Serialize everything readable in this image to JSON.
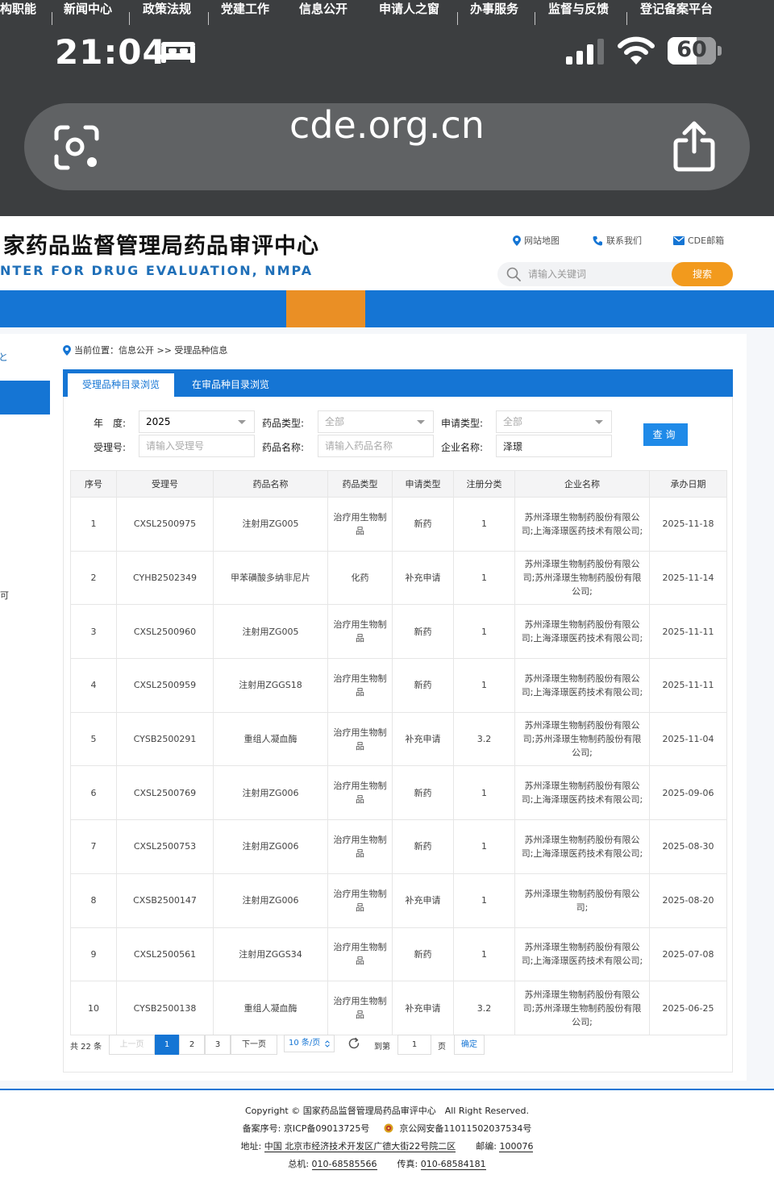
{
  "status_bar": {
    "time": "21:04",
    "battery": "60",
    "battery_level": 0.6
  },
  "browser": {
    "url": "cde.org.cn"
  },
  "site": {
    "title": "家药品监督管理局药品审评中心",
    "subtitle": "NTER FOR DRUG EVALUATION, NMPA",
    "links": {
      "sitemap": "网站地图",
      "contact": "联系我们",
      "mail": "CDE邮箱"
    },
    "search": {
      "placeholder": "请输入关键词",
      "button": "搜索"
    }
  },
  "nav": {
    "items": [
      "构职能",
      "新闻中心",
      "政策法规",
      "党建工作",
      "信息公开",
      "申请人之窗",
      "办事服务",
      "监督与反馈",
      "登记备案平台"
    ],
    "active": "信息公开"
  },
  "sidebar": {
    "fragment_top": "と",
    "fragment_mid": "可"
  },
  "breadcrumb": "当前位置：信息公开 >> 受理品种信息",
  "tabs": {
    "active": "受理品种目录浏览",
    "other": "在审品种目录浏览"
  },
  "filters": {
    "year_label": "年　度:",
    "year_value": "2025",
    "drug_type_label": "药品类型:",
    "drug_type_value": "全部",
    "apply_type_label": "申请类型:",
    "apply_type_value": "全部",
    "accept_no_label": "受理号:",
    "accept_no_placeholder": "请输入受理号",
    "drug_name_label": "药品名称:",
    "drug_name_placeholder": "请输入药品名称",
    "company_label": "企业名称:",
    "company_value": "泽璟",
    "query_button": "查询"
  },
  "table": {
    "headers": [
      "序号",
      "受理号",
      "药品名称",
      "药品类型",
      "申请类型",
      "注册分类",
      "企业名称",
      "承办日期"
    ],
    "rows": [
      [
        "1",
        "CXSL2500975",
        "注射用ZG005",
        "治疗用生物制品",
        "新药",
        "1",
        "苏州泽璟生物制药股份有限公司;上海泽璟医药技术有限公司;",
        "2025-11-18"
      ],
      [
        "2",
        "CYHB2502349",
        "甲苯磺酸多纳非尼片",
        "化药",
        "补充申请",
        "1",
        "苏州泽璟生物制药股份有限公司;苏州泽璟生物制药股份有限公司;",
        "2025-11-14"
      ],
      [
        "3",
        "CXSL2500960",
        "注射用ZG005",
        "治疗用生物制品",
        "新药",
        "1",
        "苏州泽璟生物制药股份有限公司;上海泽璟医药技术有限公司;",
        "2025-11-11"
      ],
      [
        "4",
        "CXSL2500959",
        "注射用ZGGS18",
        "治疗用生物制品",
        "新药",
        "1",
        "苏州泽璟生物制药股份有限公司;上海泽璟医药技术有限公司;",
        "2025-11-11"
      ],
      [
        "5",
        "CYSB2500291",
        "重组人凝血酶",
        "治疗用生物制品",
        "补充申请",
        "3.2",
        "苏州泽璟生物制药股份有限公司;苏州泽璟生物制药股份有限公司;",
        "2025-11-04"
      ],
      [
        "6",
        "CXSL2500769",
        "注射用ZG006",
        "治疗用生物制品",
        "新药",
        "1",
        "苏州泽璟生物制药股份有限公司;上海泽璟医药技术有限公司;",
        "2025-09-06"
      ],
      [
        "7",
        "CXSL2500753",
        "注射用ZG006",
        "治疗用生物制品",
        "新药",
        "1",
        "苏州泽璟生物制药股份有限公司;上海泽璟医药技术有限公司;",
        "2025-08-30"
      ],
      [
        "8",
        "CXSB2500147",
        "注射用ZG006",
        "治疗用生物制品",
        "补充申请",
        "1",
        "苏州泽璟生物制药股份有限公司;",
        "2025-08-20"
      ],
      [
        "9",
        "CXSL2500561",
        "注射用ZGGS34",
        "治疗用生物制品",
        "新药",
        "1",
        "苏州泽璟生物制药股份有限公司;上海泽璟医药技术有限公司;",
        "2025-07-08"
      ],
      [
        "10",
        "CYSB2500138",
        "重组人凝血酶",
        "治疗用生物制品",
        "补充申请",
        "3.2",
        "苏州泽璟生物制药股份有限公司;苏州泽璟生物制药股份有限公司;",
        "2025-06-25"
      ]
    ]
  },
  "pagination": {
    "total": "共 22 条",
    "prev": "上一页",
    "pages": [
      "1",
      "2",
      "3"
    ],
    "current": "1",
    "next": "下一页",
    "page_size": "10 条/页",
    "goto_label": "到第",
    "goto_value": "1",
    "page_unit": "页",
    "confirm": "确定"
  },
  "footer": {
    "copyright": "Copyright © 国家药品监督管理局药品审评中心　All Right Reserved.",
    "icp_label": "备案序号:",
    "icp": "京ICP备09013725号",
    "gongan": "京公网安备11011502037534号",
    "address_label": "地址:",
    "address": "中国 北京市经济技术开发区广德大街22号院二区",
    "postcode_label": "邮编:",
    "postcode": "100076",
    "phone_label": "总机:",
    "phone": "010-68585566",
    "fax_label": "传真:",
    "fax": "010-68584181"
  }
}
